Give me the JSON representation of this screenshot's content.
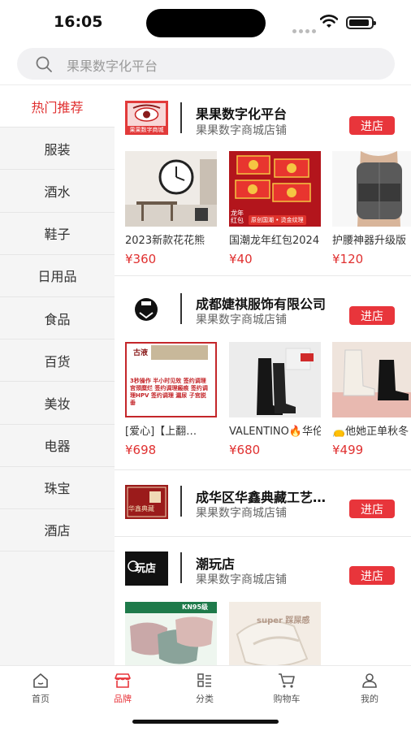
{
  "status": {
    "time": "16:05"
  },
  "search": {
    "placeholder": "果果数字化平台"
  },
  "sidebar": {
    "items": [
      {
        "label": "热门推荐",
        "active": true
      },
      {
        "label": "服装"
      },
      {
        "label": "酒水"
      },
      {
        "label": "鞋子"
      },
      {
        "label": "日用品"
      },
      {
        "label": "食品"
      },
      {
        "label": "百货"
      },
      {
        "label": "美妆"
      },
      {
        "label": "电器"
      },
      {
        "label": "珠宝"
      },
      {
        "label": "酒店"
      }
    ]
  },
  "stores": [
    {
      "name": "果果数字化平台",
      "sub": "果果数字商城店铺",
      "enter": "进店",
      "logo_text": "果果数字商城",
      "products": [
        {
          "title": "2023新款花花熊",
          "price": "¥360"
        },
        {
          "title": "国潮龙年红包2024",
          "price": "¥40",
          "badge1": "龙年红包",
          "badge2": "原创国潮 • 烫金纹理"
        },
        {
          "title": "护腰神器升级版",
          "price": "¥120"
        }
      ]
    },
    {
      "name": "成都婕祺服饰有限公司",
      "sub": "果果数字商城店铺",
      "enter": "进店",
      "products": [
        {
          "title": "[爱心]【上翻…",
          "price": "¥698",
          "img_text": "3秒操作 半小时见效 签约调理宫颈糜烂 签约调理瘢痕 签约调理HPV 签约调理 漏尿 子宫脱垂",
          "img_head": "古液"
        },
        {
          "title": "VALENTINO🔥华伦",
          "price": "¥680"
        },
        {
          "title": "👝他她正单秋冬",
          "price": "¥499"
        }
      ]
    },
    {
      "name": "成华区华鑫典藏工艺…",
      "sub": "果果数字商城店铺",
      "enter": "进店",
      "logo_text": "华鑫典藏"
    },
    {
      "name": "潮玩店",
      "sub": "果果数字商城店铺",
      "enter": "进店",
      "logo_text": "玩店",
      "products": [
        {
          "title": "",
          "price": "",
          "img_text": "KN95级"
        },
        {
          "title": "",
          "price": "",
          "img_text": "super 踩屎感"
        }
      ]
    }
  ],
  "tabbar": {
    "items": [
      {
        "label": "首页",
        "icon": "home-icon"
      },
      {
        "label": "品牌",
        "icon": "store-icon",
        "active": true
      },
      {
        "label": "分类",
        "icon": "category-icon"
      },
      {
        "label": "购物车",
        "icon": "cart-icon"
      },
      {
        "label": "我的",
        "icon": "user-icon"
      }
    ]
  },
  "colors": {
    "accent": "#e8353b",
    "sidebar_bg": "#f5f5f5"
  }
}
